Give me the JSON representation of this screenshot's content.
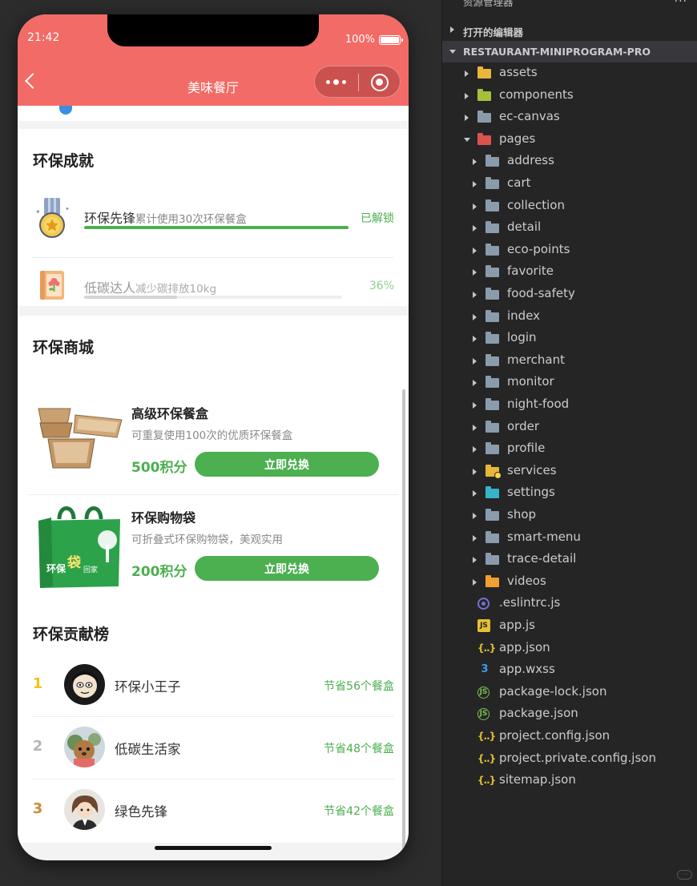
{
  "status_bar": {
    "time": "21:42",
    "battery": "100%"
  },
  "nav": {
    "title": "美味餐厅"
  },
  "achievements": {
    "title": "环保成就",
    "items": [
      {
        "name": "环保先锋",
        "desc": "累计使用30次环保餐盒",
        "status": "已解锁",
        "progress": 1.0
      },
      {
        "name": "低碳达人",
        "desc": "减少碳排放10kg",
        "status": "36%",
        "progress": 0.36
      }
    ]
  },
  "shop": {
    "title": "环保商城",
    "items": [
      {
        "name": "高级环保餐盒",
        "desc": "可重复使用100次的优质环保餐盒",
        "points": "500积分",
        "button": "立即兑换"
      },
      {
        "name": "环保购物袋",
        "desc": "可折叠式环保购物袋，美观实用",
        "points": "200积分",
        "button": "立即兑换",
        "bag_text_1": "环保",
        "bag_text_2": "袋",
        "bag_text_3": "回家"
      }
    ]
  },
  "ranking": {
    "title": "环保贡献榜",
    "items": [
      {
        "rank": "1",
        "name": "环保小王子",
        "saved": "节省56个餐盒",
        "color": "#f0c419"
      },
      {
        "rank": "2",
        "name": "低碳生活家",
        "saved": "节省48个餐盒",
        "color": "#b5b5b5"
      },
      {
        "rank": "3",
        "name": "绿色先锋",
        "saved": "节省42个餐盒",
        "color": "#d08a3c"
      }
    ]
  },
  "explorer": {
    "header": "资源管理器",
    "more": "···",
    "open_editors": "打开的编辑器",
    "project": "RESTAURANT-MINIPROGRAM-PRO",
    "root_folders": [
      "assets",
      "components",
      "ec-canvas",
      "pages"
    ],
    "pages": [
      "address",
      "cart",
      "collection",
      "detail",
      "eco-points",
      "favorite",
      "food-safety",
      "index",
      "login",
      "merchant",
      "monitor",
      "night-food",
      "order",
      "profile",
      "services",
      "settings",
      "shop",
      "smart-menu",
      "trace-detail",
      "videos"
    ],
    "files": [
      ".eslintrc.js",
      "app.js",
      "app.json",
      "app.wxss",
      "package-lock.json",
      "package.json",
      "project.config.json",
      "project.private.config.json",
      "sitemap.json"
    ]
  },
  "colors": {
    "nav": "#f36b66",
    "accent": "#4caf50",
    "explorer_bg": "#252526"
  }
}
